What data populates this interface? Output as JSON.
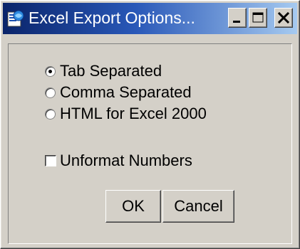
{
  "window": {
    "title": "Excel Export Options...",
    "controls": {
      "minimize_icon": "minimize-icon",
      "maximize_icon": "maximize-icon",
      "close_icon": "close-icon"
    }
  },
  "options": {
    "selected": "Tab Separated",
    "radios": [
      {
        "label": "Tab Separated",
        "checked": true
      },
      {
        "label": "Comma Separated",
        "checked": false
      },
      {
        "label": "HTML for Excel 2000",
        "checked": false
      }
    ],
    "unformat_numbers": {
      "label": "Unformat Numbers",
      "checked": false
    }
  },
  "buttons": {
    "ok_label": "OK",
    "cancel_label": "Cancel"
  },
  "colors": {
    "title_gradient_start": "#0a246a",
    "title_gradient_end": "#a6caf0",
    "face": "#d4d0c8"
  }
}
